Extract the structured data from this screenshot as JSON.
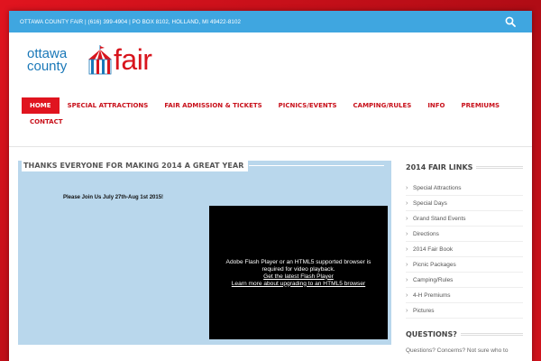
{
  "topbar": {
    "contact_line": "OTTAWA COUNTY FAIR | (616) 399-4904 | PO BOX 8102, HOLLAND, MI 49422-8102"
  },
  "logo": {
    "line1": "ottawa",
    "line2": "county",
    "word": "fair"
  },
  "nav": {
    "items": [
      {
        "label": "HOME",
        "active": true
      },
      {
        "label": "SPECIAL ATTRACTIONS"
      },
      {
        "label": "FAIR ADMISSION & TICKETS"
      },
      {
        "label": "PICNICS/EVENTS"
      },
      {
        "label": "CAMPING/RULES"
      },
      {
        "label": "INFO"
      },
      {
        "label": "PREMIUMS"
      },
      {
        "label": "CONTACT"
      }
    ]
  },
  "main": {
    "title": "THANKS EVERYONE FOR MAKING 2014 A GREAT YEAR",
    "join_text": "Please Join Us July 27th-Aug 1st 2015!",
    "video": {
      "line1": "Adobe Flash Player or an HTML5 supported browser is",
      "line2": "required for video playback.",
      "link1": "Get the latest Flash Player",
      "link2": "Learn more about upgrading to an HTML5 browser"
    }
  },
  "sidebar": {
    "links_title": "2014 FAIR LINKS",
    "links": [
      "Special Attractions",
      "Special Days",
      "Grand Stand Events",
      "Directions",
      "2014 Fair Book",
      "Picnic Packages",
      "Camping/Rules",
      "4-H Premiums",
      "Pictures"
    ],
    "questions_title": "QUESTIONS?",
    "questions_text": "Questions? Concerns? Not sure who to"
  },
  "colors": {
    "accent_red": "#e0141f",
    "topbar_blue": "#3fa6e0",
    "main_bg": "#b9d7ec"
  }
}
